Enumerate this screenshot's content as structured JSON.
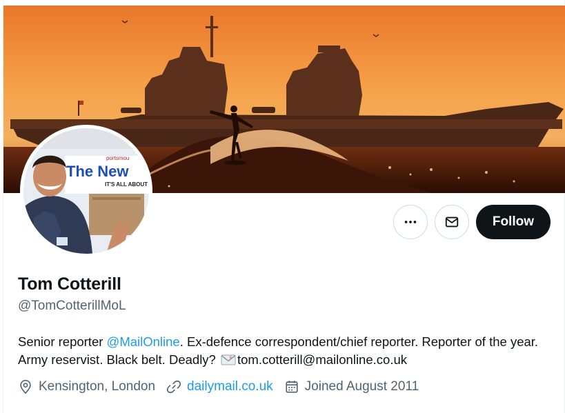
{
  "profile": {
    "name": "Tom Cotterill",
    "handle": "@TomCotterillMoL",
    "bio": {
      "before_mention": "Senior reporter ",
      "mention": "@MailOnline",
      "after_mention": ". Ex-defence correspondent/chief reporter. Reporter of the year. Army reservist. Black belt. Deadly? ",
      "envelope_icon": "envelope-emoji-icon",
      "email": "tom.cotterill@mailonline.co.uk"
    },
    "location": "Kensington, London",
    "website": "dailymail.co.uk",
    "joined": "Joined August 2011"
  },
  "actions": {
    "more_icon": "more-horizontal-icon",
    "message_icon": "envelope-icon",
    "follow_label": "Follow"
  },
  "banner": {
    "description_icon": "aircraft-carrier-surfer-banner"
  },
  "avatar": {
    "sign_text": "The New",
    "sign_subtext": "IT'S ALL ABOUT",
    "sign_top": "portsmou"
  },
  "colors": {
    "accent": "#1d9bf0",
    "text_primary": "#0f1419",
    "text_secondary": "#536471",
    "follow_bg": "#0f1419",
    "border": "#cfd9de",
    "banner_sky": "#f39a3c"
  }
}
